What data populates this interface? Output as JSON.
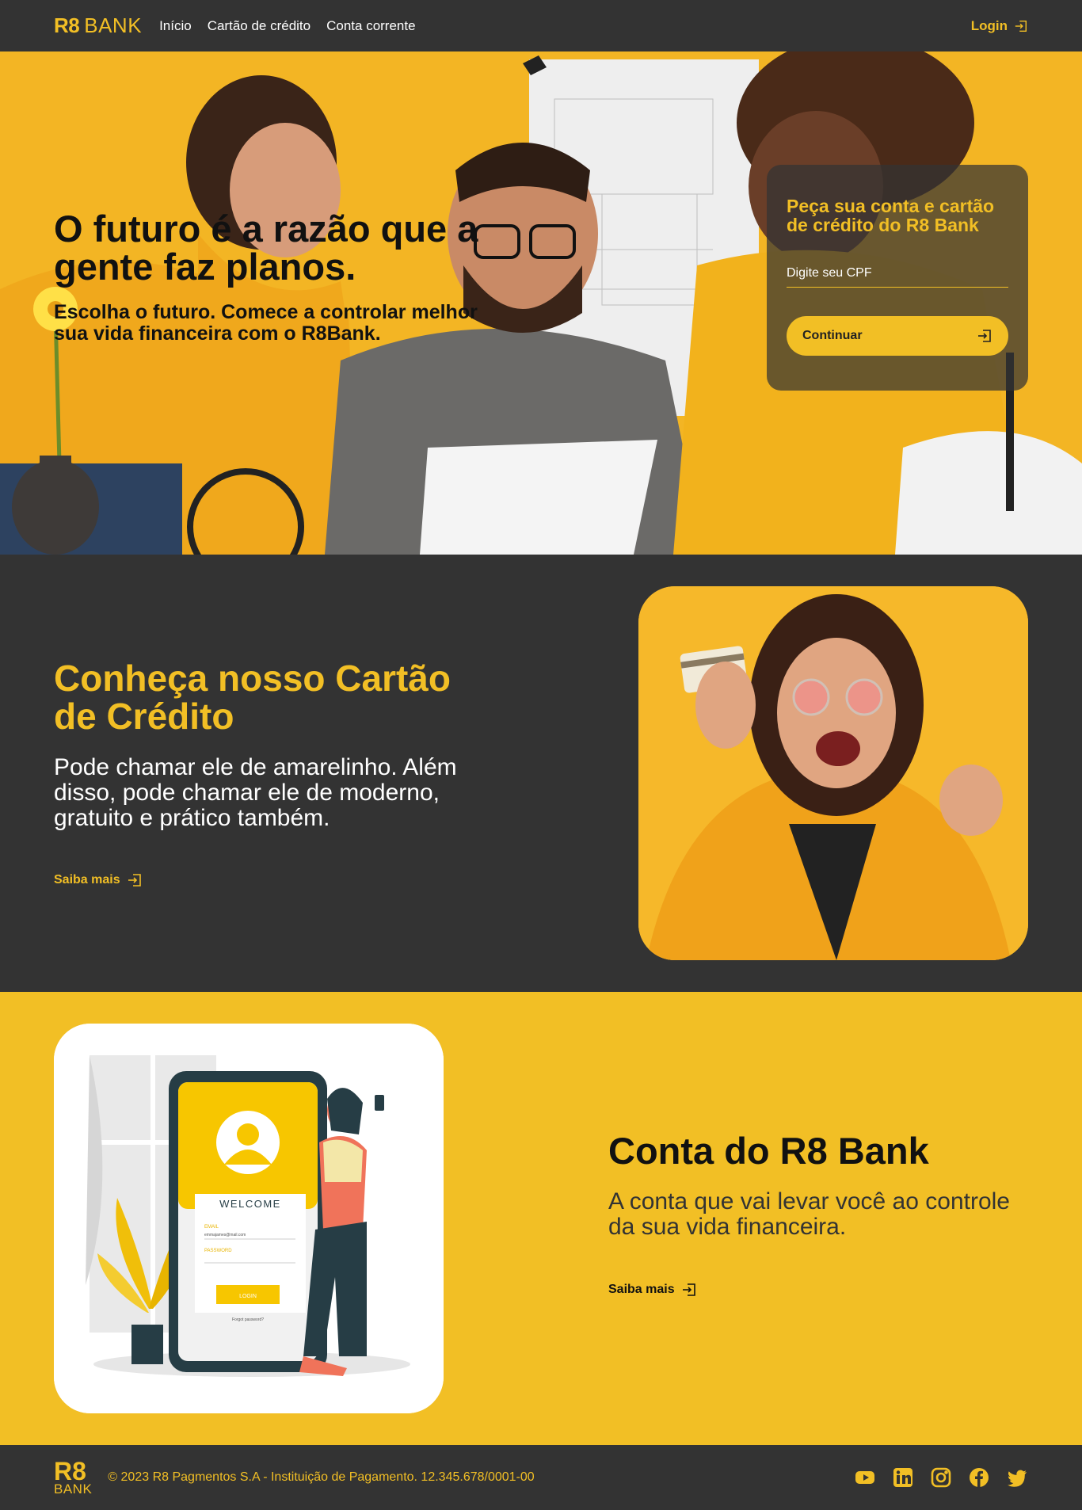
{
  "nav": {
    "logo_r8": "R8",
    "logo_bank": "BANK",
    "links": [
      "Início",
      "Cartão de crédito",
      "Conta corrente"
    ],
    "login_label": "Login"
  },
  "hero": {
    "title": "O futuro é a razão que a gente faz planos.",
    "subtitle": "Escolha o futuro. Comece a controlar melhor sua vida financeira com o R8Bank.",
    "form": {
      "title": "Peça sua conta e cartão de crédito do R8 Bank",
      "cpf_placeholder": "Digite seu CPF",
      "cpf_value": "",
      "button_label": "Continuar"
    }
  },
  "card_section": {
    "title": "Conheça nosso Cartão de Crédito",
    "description": "Pode chamar ele de amarelinho. Além disso, pode chamar ele de moderno, gratuito e prático também.",
    "link_label": "Saiba mais"
  },
  "account_section": {
    "title": "Conta do R8 Bank",
    "description": "A conta que vai levar você ao controle da sua vida financeira.",
    "link_label": "Saiba mais",
    "illustration": {
      "welcome": "WELCOME",
      "email_label": "EMAIL",
      "email_value": "emmajames@mail.com",
      "password_label": "PASSWORD",
      "login_button": "LOGIN",
      "forgot": "Forgot password?"
    }
  },
  "footer": {
    "logo_r8": "R8",
    "logo_bank": "BANK",
    "copyright": "© 2023 R8 Pagmentos S.A - Instituição de Pagamento. 12.345.678/0001-00",
    "socials": [
      "youtube-icon",
      "linkedin-icon",
      "instagram-icon",
      "facebook-icon",
      "twitter-icon"
    ]
  },
  "colors": {
    "brand_yellow": "#f2bf25",
    "dark": "#333333"
  }
}
